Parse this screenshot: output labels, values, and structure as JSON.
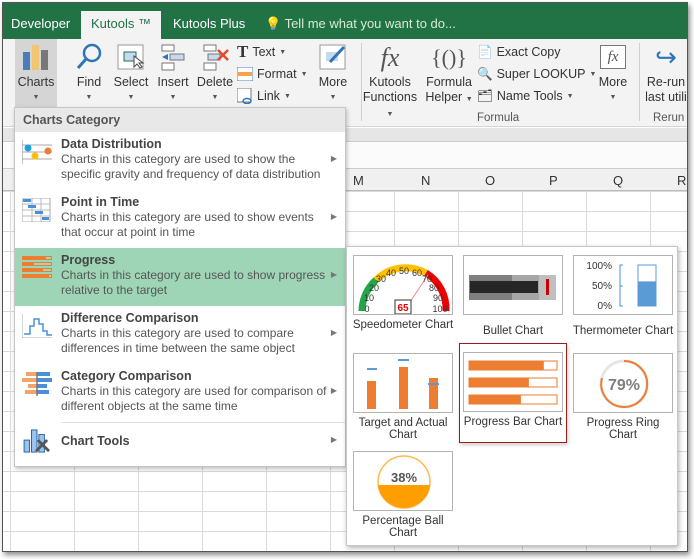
{
  "tabs": [
    {
      "label": "Developer"
    },
    {
      "label": "Kutools ™"
    },
    {
      "label": "Kutools Plus"
    }
  ],
  "tell_me": "Tell me what you want to do...",
  "ribbon": {
    "charts": "Charts",
    "find": "Find",
    "select": "Select",
    "insert": "Insert",
    "delete": "Delete",
    "text": "Text",
    "format": "Format",
    "link": "Link",
    "more1": "More",
    "kutools_functions_1": "Kutools",
    "kutools_functions_2": "Functions",
    "formula_helper_1": "Formula",
    "formula_helper_2": "Helper",
    "exact_copy": "Exact Copy",
    "super_lookup": "Super LOOKUP",
    "name_tools": "Name Tools",
    "more2": "More",
    "rerun_1": "Re-run",
    "rerun_2": "last utili",
    "group_formula": "Formula",
    "group_rerun": "Rerun"
  },
  "columns": [
    "M",
    "N",
    "O",
    "P",
    "Q",
    "R"
  ],
  "menu": {
    "header": "Charts Category",
    "items": [
      {
        "title": "Data Distribution",
        "desc": "Charts in this category are used to show the specific gravity and frequency of data distribution"
      },
      {
        "title": "Point in Time",
        "desc": "Charts in this category are used to show events that occur at point in time"
      },
      {
        "title": "Progress",
        "desc": "Charts in this category are used to show progress relative to the target",
        "selected": true
      },
      {
        "title": "Difference Comparison",
        "desc": "Charts in this category are used to compare differences in time between the same object"
      },
      {
        "title": "Category Comparison",
        "desc": "Charts in this category are used for comparison of different objects at the same time"
      },
      {
        "title": "Chart Tools",
        "desc": ""
      }
    ]
  },
  "gallery": {
    "items": [
      {
        "label": "Speedometer Chart",
        "value": "65",
        "ticks": [
          "0",
          "10",
          "20",
          "30",
          "40",
          "50",
          "60",
          "70",
          "80",
          "90",
          "100"
        ]
      },
      {
        "label": "Bullet Chart"
      },
      {
        "label": "Thermometer Chart",
        "ticks": [
          "100%",
          "50%",
          "0%"
        ],
        "fill": 0.6
      },
      {
        "label": "Target and Actual Chart"
      },
      {
        "label": "Progress Bar Chart",
        "selected": true,
        "fills": [
          0.85,
          0.68,
          0.59
        ]
      },
      {
        "label": "Progress Ring Chart",
        "value": "79%"
      },
      {
        "label": "Percentage Ball Chart",
        "value": "38%"
      }
    ]
  },
  "colors": {
    "excel_green": "#217346",
    "accent_orange": "#ed7d31",
    "selected_row": "#9fd5b7",
    "selected_border": "#9b1c1c"
  }
}
